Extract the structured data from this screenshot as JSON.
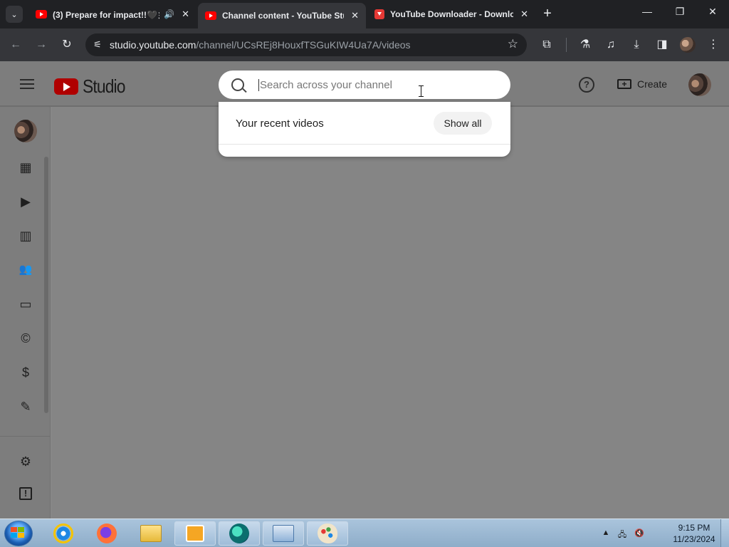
{
  "browser": {
    "tabs": [
      {
        "title": "(3) Prepare for impact!!🖤彡",
        "has_audio": true,
        "close": "✕"
      },
      {
        "title": "Channel content - YouTube Stu",
        "active": true,
        "close": "✕"
      },
      {
        "title": "YouTube Downloader - Downlo",
        "close": "✕"
      }
    ],
    "tab_search_glyph": "⌄",
    "new_tab_glyph": "+",
    "window_controls": {
      "minimize": "—",
      "restore": "❐",
      "close": "✕"
    },
    "url_host": "studio.youtube.com",
    "url_path": "/channel/UCsREj8HouxfTSGuKIW4Ua7A/videos",
    "icons": {
      "back": "back-arrow-icon",
      "forward": "forward-arrow-icon",
      "reload": "reload-icon",
      "site_info": "tune-icon",
      "bookmark": "star-icon",
      "extensions": "puzzle-icon",
      "labs": "flask-icon",
      "media": "media-control-icon",
      "downloads": "download-icon",
      "side_panel": "side-panel-icon",
      "menu": "kebab-menu-icon"
    },
    "glyphs": {
      "back": "←",
      "forward": "→",
      "reload": "↻",
      "tune": "⚟",
      "star": "☆",
      "extensions": "⧉",
      "labs": "⚗",
      "media": "♫",
      "downloads": "⤓",
      "side_panel": "◨",
      "menu": "⋮"
    }
  },
  "studio": {
    "logo_text": "Studio",
    "create_label": "Create",
    "help_glyph": "?",
    "create_glyph": "+",
    "sidebar": [
      {
        "name": "dashboard-icon",
        "glyph": "▦"
      },
      {
        "name": "content-icon",
        "glyph": "▶"
      },
      {
        "name": "analytics-icon",
        "glyph": "▥"
      },
      {
        "name": "community-icon",
        "glyph": "👥"
      },
      {
        "name": "subtitles-icon",
        "glyph": "▭"
      },
      {
        "name": "copyright-icon",
        "glyph": "©"
      },
      {
        "name": "earn-icon",
        "glyph": "$"
      },
      {
        "name": "customization-icon",
        "glyph": "✎"
      },
      {
        "name": "audio-library-icon",
        "glyph": "▬"
      },
      {
        "name": "settings-icon",
        "glyph": "⚙"
      },
      {
        "name": "feedback-icon",
        "glyph": "!"
      }
    ]
  },
  "search": {
    "placeholder": "Search across your channel",
    "recent_title": "Your recent videos",
    "show_all": "Show all"
  },
  "taskbar": {
    "apps": [
      "internet-explorer",
      "firefox",
      "file-explorer",
      "media-player",
      "browser-app",
      "control-panel",
      "paint"
    ],
    "tray_glyphs": {
      "expand": "▲",
      "network": "🖧",
      "volume": "🔇"
    },
    "time": "9:15 PM",
    "date": "11/23/2024"
  },
  "colors": {
    "chrome_dark": "#202124",
    "chrome_toolbar": "#35363a",
    "youtube_red": "#ff0000",
    "overlay_gray": "#858585",
    "taskbar_blue": "#9ebcd8"
  }
}
